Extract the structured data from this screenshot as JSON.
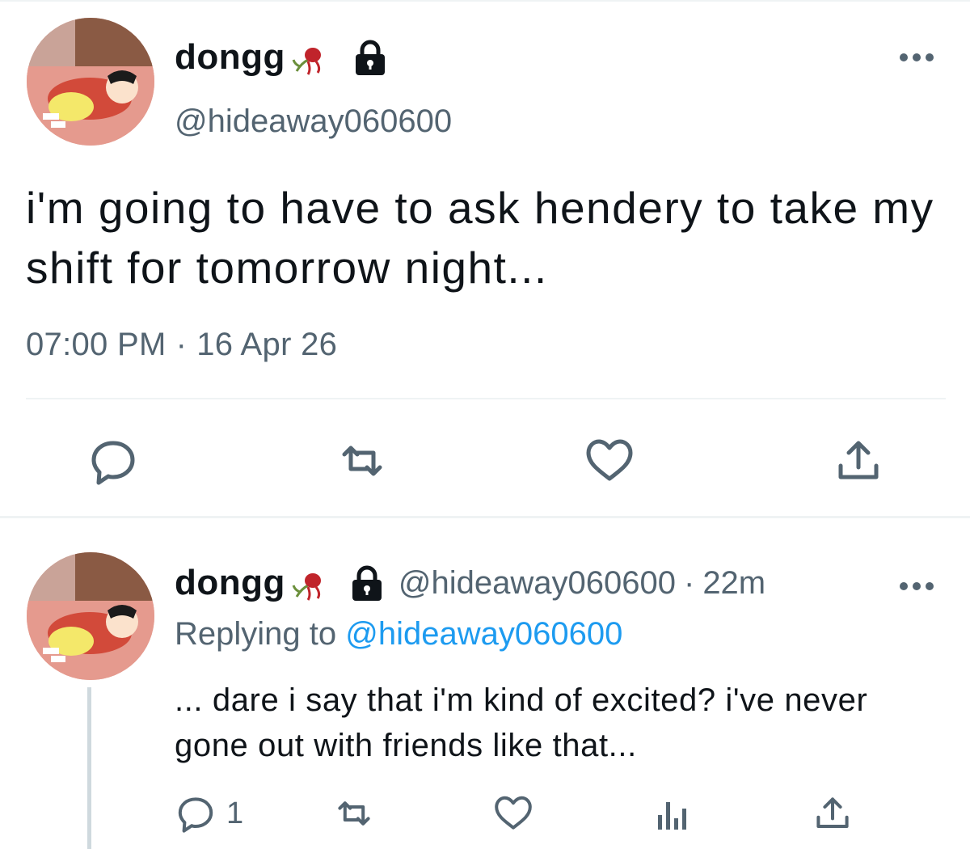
{
  "main_tweet": {
    "display_name": "dongg",
    "handle": "@hideaway060600",
    "text": "i'm going to have to ask hendery to take my shift for tomorrow night...",
    "time": "07:00 PM",
    "date": "16 Apr 26",
    "separator": "·",
    "icons": {
      "avatar": "avatar-cartoon",
      "name_emoji": "wilted-rose-icon",
      "protected": "lock-icon",
      "more": "more-icon",
      "reply": "reply-icon",
      "retweet": "retweet-icon",
      "like": "heart-icon",
      "share": "share-icon"
    }
  },
  "reply_tweet": {
    "display_name": "dongg",
    "handle": "@hideaway060600",
    "separator": "·",
    "relative_time": "22m",
    "replying_prefix": "Replying to",
    "replying_handle": "@hideaway060600",
    "text": "... dare i say that i'm kind of excited? i've never gone out with friends like that...",
    "reply_count": "1",
    "icons": {
      "reply": "reply-icon",
      "retweet": "retweet-icon",
      "like": "heart-icon",
      "analytics": "analytics-icon",
      "share": "share-icon"
    }
  },
  "colors": {
    "text": "#0f1419",
    "secondary": "#536471",
    "link": "#1d9bf0",
    "divider": "#eff3f4",
    "thread_line": "#cfd9de"
  }
}
